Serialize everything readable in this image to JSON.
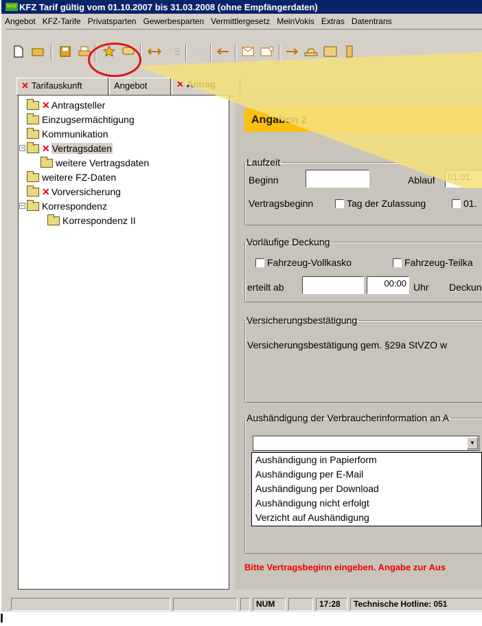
{
  "window": {
    "title": "KFZ Tarif gültig vom 01.10.2007 bis 31.03.2008 (ohne Empfängerdaten)",
    "app_icon": "MVO"
  },
  "menu": [
    "Angebot",
    "KFZ-Tarife",
    "Privatsparten",
    "Gewerbesparten",
    "Vermittlergesetz",
    "MeinVokis",
    "Extras",
    "Datentrans"
  ],
  "toolbar_icons": [
    "new-document-icon",
    "open-folder-icon",
    "save-disk-icon",
    "print-icon",
    "star-icon",
    "comment-icon",
    "swap-arrows-icon",
    "user-list-icon",
    "user-group-icon",
    "arrow-left-icon",
    "envelope-icon",
    "envelope-add-icon",
    "arrow-right-icon",
    "car-icon",
    "family-icon",
    "flask-icon"
  ],
  "tabs": [
    {
      "label": "Tarifauskunft",
      "error": true
    },
    {
      "label": "Angebot",
      "error": false
    },
    {
      "label": "Antrag",
      "error": true
    }
  ],
  "tree": [
    {
      "label": "Antragsteller",
      "error": true,
      "level": 0
    },
    {
      "label": "Einzugsermächtigung",
      "error": false,
      "level": 0
    },
    {
      "label": "Kommunikation",
      "error": false,
      "level": 0
    },
    {
      "label": "Vertragsdaten",
      "error": true,
      "level": 0,
      "expanded": true,
      "selected": true
    },
    {
      "label": "weitere Vertragsdaten",
      "error": false,
      "level": 1
    },
    {
      "label": "weitere FZ-Daten",
      "error": false,
      "level": 0
    },
    {
      "label": "Vorversicherung",
      "error": true,
      "level": 0
    },
    {
      "label": "Korrespondenz",
      "error": false,
      "level": 0,
      "expanded": true
    },
    {
      "label": "Korrespondenz II",
      "error": false,
      "level": 1
    }
  ],
  "section_heading": "Angaben z",
  "laufzeit": {
    "legend": "Laufzeit",
    "beginn_label": "Beginn",
    "beginn_value": "",
    "ablauf_label": "Ablauf",
    "ablauf_value": "01.01.",
    "vertragsbeginn_label": "Vertragsbeginn",
    "opt1": "Tag der Zulassung",
    "opt2": "01."
  },
  "deckung": {
    "legend": "Vorläufige Deckung",
    "cb1": "Fahrzeug-Vollkasko",
    "cb2": "Fahrzeug-Teilka",
    "erteilt_label": "erteilt ab",
    "date_value": "",
    "time_value": "00:00",
    "uhr": "Uhr",
    "deckung": "Deckun"
  },
  "bestaetigung": {
    "legend": "Versicherungsbestätigung",
    "text": "Versicherungsbestätigung gem. §29a StVZO w"
  },
  "aushaendigung": {
    "legend": "Aushändigung der Verbraucherinformation an A",
    "selected": "",
    "options": [
      "Aushändigung in Papierform",
      "Aushändigung per E-Mail",
      "Aushändigung per Download",
      "Aushändigung nicht erfolgt",
      "Verzicht auf Aushändigung"
    ]
  },
  "error_message": "Bitte Vertragsbeginn eingeben. Angabe zur Aus",
  "status": {
    "num": "NUM",
    "time": "17:28",
    "hotline": "Technische Hotline: 051"
  },
  "colors": {
    "accent": "#fcc10e",
    "highlight": "#e0121c",
    "error": "#e00000"
  }
}
